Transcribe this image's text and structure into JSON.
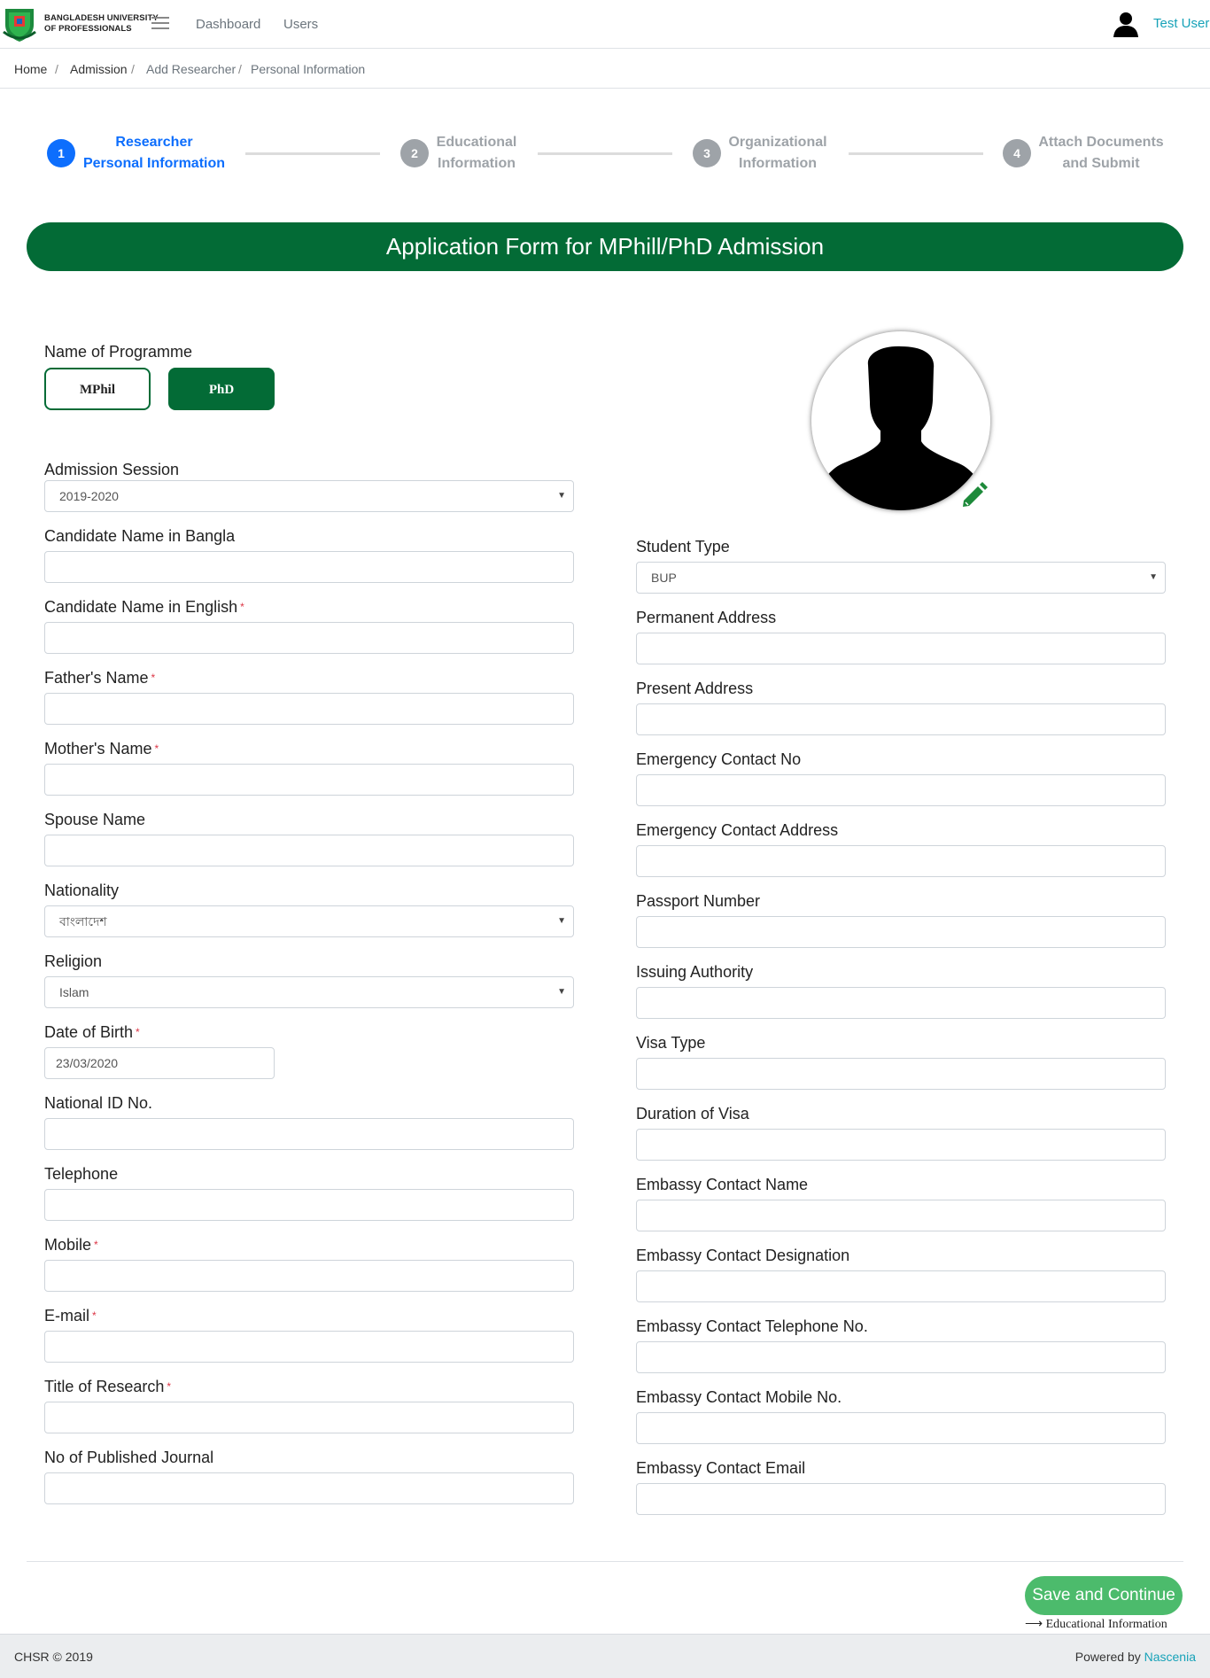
{
  "header": {
    "brand_line1": "BANGLADESH UNIVERSITY",
    "brand_line2": "OF PROFESSIONALS",
    "nav": [
      "Dashboard",
      "Users"
    ],
    "user_name": "Test User"
  },
  "breadcrumb": {
    "items": [
      "Home",
      "Admission",
      "Add Researcher",
      "Personal Information"
    ],
    "separator": "/"
  },
  "stepper": {
    "steps": [
      {
        "num": "1",
        "line1": "Researcher",
        "line2": "Personal Information",
        "active": true
      },
      {
        "num": "2",
        "line1": "Educational",
        "line2": "Information",
        "active": false
      },
      {
        "num": "3",
        "line1": "Organizational",
        "line2": "Information",
        "active": false
      },
      {
        "num": "4",
        "line1": "Attach Documents",
        "line2": "and Submit",
        "active": false
      }
    ],
    "active_color": "#0d6efd",
    "inactive_color": "#9ea3a8"
  },
  "banner": {
    "title": "Application Form for MPhill/PhD Admission",
    "color": "#036b36"
  },
  "programme": {
    "label": "Name of Programme",
    "options": [
      "MPhil",
      "PhD"
    ],
    "selected": "PhD"
  },
  "left_fields": {
    "admission_session": {
      "label": "Admission Session",
      "value": "2019-2020"
    },
    "name_bangla": {
      "label": "Candidate Name in Bangla",
      "value": ""
    },
    "name_english": {
      "label": "Candidate Name in English",
      "value": ""
    },
    "father_name": {
      "label": "Father's Name",
      "value": ""
    },
    "mother_name": {
      "label": "Mother's Name",
      "value": ""
    },
    "spouse_name": {
      "label": "Spouse Name",
      "value": ""
    },
    "nationality": {
      "label": "Nationality",
      "value": "বাংলাদেশ"
    },
    "religion": {
      "label": "Religion",
      "value": "Islam"
    },
    "dob": {
      "label": "Date of Birth",
      "value": "23/03/2020"
    },
    "nid": {
      "label": "National ID No.",
      "value": ""
    },
    "telephone": {
      "label": "Telephone",
      "value": ""
    },
    "mobile": {
      "label": "Mobile",
      "value": ""
    },
    "email": {
      "label": "E-mail",
      "value": ""
    },
    "research_title": {
      "label": "Title of Research",
      "value": ""
    },
    "published_journal": {
      "label": "No of Published Journal",
      "value": ""
    }
  },
  "right_fields": {
    "student_type": {
      "label": "Student Type",
      "value": "BUP"
    },
    "permanent_address": {
      "label": "Permanent Address",
      "value": ""
    },
    "present_address": {
      "label": "Present Address",
      "value": ""
    },
    "emergency_contact_no": {
      "label": "Emergency Contact No",
      "value": ""
    },
    "emergency_contact_address": {
      "label": "Emergency Contact Address",
      "value": ""
    },
    "passport_number": {
      "label": "Passport Number",
      "value": ""
    },
    "issuing_authority": {
      "label": "Issuing Authority",
      "value": ""
    },
    "visa_type": {
      "label": "Visa Type",
      "value": ""
    },
    "visa_duration": {
      "label": "Duration of Visa",
      "value": ""
    },
    "embassy_name": {
      "label": "Embassy Contact Name",
      "value": ""
    },
    "embassy_designation": {
      "label": "Embassy Contact Designation",
      "value": ""
    },
    "embassy_telephone": {
      "label": "Embassy Contact Telephone No.",
      "value": ""
    },
    "embassy_mobile": {
      "label": "Embassy Contact Mobile No.",
      "value": ""
    },
    "embassy_email": {
      "label": "Embassy Contact Email",
      "value": ""
    }
  },
  "actions": {
    "save_label": "Save and Continue",
    "next_hint": "Educational Information",
    "save_color": "#4cbb6c"
  },
  "footer": {
    "copyright": "CHSR © 2019",
    "powered_prefix": "Powered by",
    "powered_link": "Nascenia"
  }
}
